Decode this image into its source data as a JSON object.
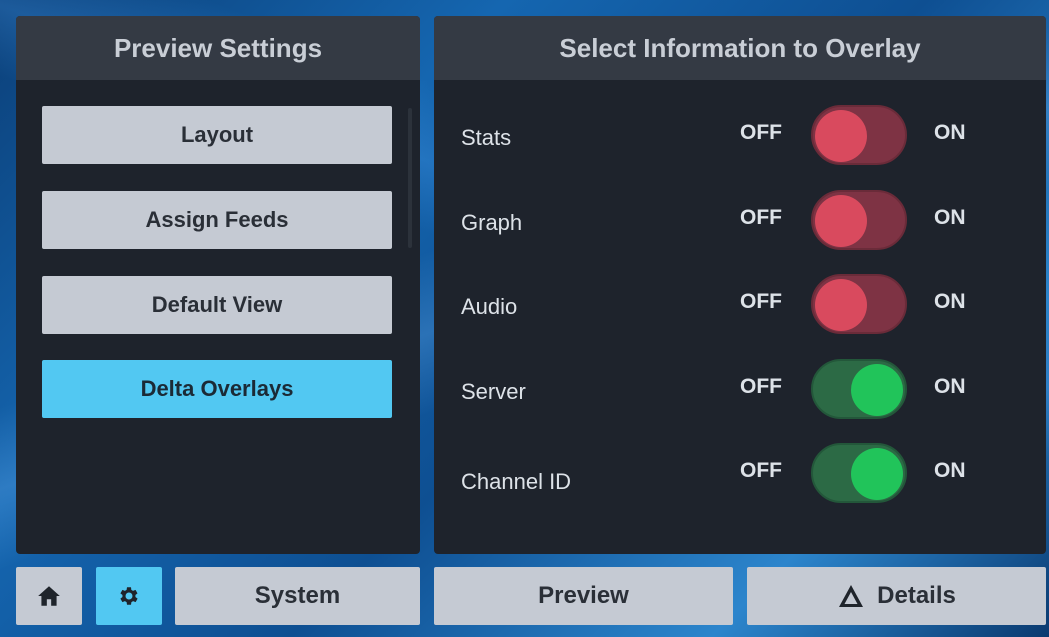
{
  "left_panel": {
    "title": "Preview Settings",
    "items": [
      {
        "label": "Layout",
        "active": false
      },
      {
        "label": "Assign Feeds",
        "active": false
      },
      {
        "label": "Default View",
        "active": false
      },
      {
        "label": "Delta Overlays",
        "active": true
      }
    ]
  },
  "right_panel": {
    "title": "Select Information to Overlay",
    "off_label": "OFF",
    "on_label": "ON",
    "rows": [
      {
        "label": "Stats",
        "state": "off"
      },
      {
        "label": "Graph",
        "state": "off"
      },
      {
        "label": "Audio",
        "state": "off"
      },
      {
        "label": "Server",
        "state": "on"
      },
      {
        "label": "Channel ID",
        "state": "on"
      }
    ]
  },
  "bottom_bar": {
    "home_icon": "home-icon",
    "settings_icon": "gear-icon",
    "system_label": "System",
    "preview_label": "Preview",
    "details_label": "Details",
    "details_icon": "delta-icon"
  },
  "colors": {
    "active_accent": "#52c8f2",
    "toggle_off": "#d94a5e",
    "toggle_on": "#21c45a"
  }
}
